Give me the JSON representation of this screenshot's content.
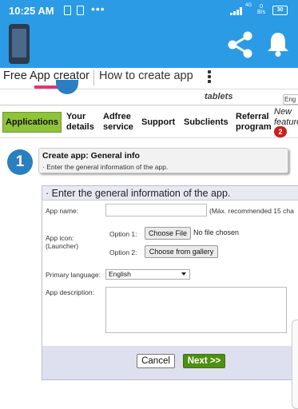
{
  "status_bar": {
    "time": "10:25 AM",
    "dots": "•••",
    "network_label": "4G",
    "speed_value": "0",
    "speed_unit": "B/s",
    "battery": "30"
  },
  "tabs": {
    "tab1_label": "Free App creator",
    "tab2_label": "How to create app"
  },
  "header": {
    "tagline": "tablets",
    "language": "Eng"
  },
  "nav": {
    "applications": "Applications",
    "your": "Your",
    "details": "details",
    "adfree": "Adfree",
    "service": "service",
    "support": "Support",
    "subclients": "Subclients",
    "referral": "Referral",
    "program": "program",
    "new": "New",
    "features": "features",
    "badge": "2"
  },
  "step": {
    "number": "1",
    "title": "Create app: General info",
    "subtitle": "· Enter the general information of the app."
  },
  "form": {
    "title": "· Enter the general information of the app.",
    "app_name_label": "App name:",
    "app_name_value": "",
    "app_name_hint": "(Máx. recommended 15 cha",
    "app_icon_label": "App icon:",
    "app_icon_sub": "(Launcher)",
    "option1_label": "Option 1:",
    "choose_file": "Choose File",
    "no_file": "No file chosen",
    "option2_label": "Option 2:",
    "choose_gallery": "Choose from gallery",
    "language_label": "Primary language:",
    "language_value": "English",
    "description_label": "App description:",
    "description_value": "",
    "cancel": "Cancel",
    "next": "Next >>"
  },
  "colors": {
    "app_bar": "#2b9be6",
    "tab_indicator": "#e8336d",
    "nav_active": "#8fc33a",
    "next_button": "#4e8f12",
    "step_circle": "#2a7fc1"
  }
}
